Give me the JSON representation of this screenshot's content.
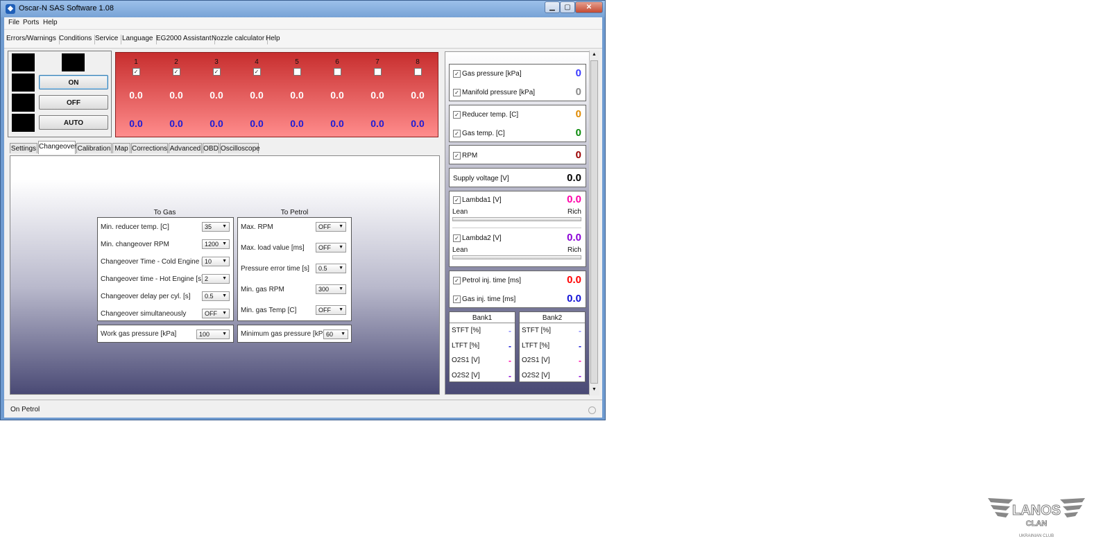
{
  "window": {
    "title": "Oscar-N SAS Software 1.08",
    "minimize": "▁",
    "maximize": "▢",
    "close": "✕"
  },
  "menu": [
    "File",
    "Ports",
    "Help"
  ],
  "toolbar": [
    "Errors/Warnings",
    "Conditions",
    "Service",
    "Language",
    "EG2000 Assistant",
    "Nozzle calculator",
    "Help"
  ],
  "mode_buttons": {
    "on": "ON",
    "off": "OFF",
    "auto": "AUTO"
  },
  "injectors": {
    "numbers": [
      "1",
      "2",
      "3",
      "4",
      "5",
      "6",
      "7",
      "8"
    ],
    "checked": [
      true,
      true,
      true,
      true,
      false,
      false,
      false,
      false
    ],
    "petrol": [
      "0.0",
      "0.0",
      "0.0",
      "0.0",
      "0.0",
      "0.0",
      "0.0",
      "0.0"
    ],
    "gas": [
      "0.0",
      "0.0",
      "0.0",
      "0.0",
      "0.0",
      "0.0",
      "0.0",
      "0.0"
    ]
  },
  "tabs": [
    "Settings",
    "Changeover",
    "Calibration",
    "Map",
    "Corrections",
    "Advanced",
    "OBD",
    "Oscilloscope"
  ],
  "active_tab": "Changeover",
  "to_gas": {
    "title": "To Gas",
    "rows": [
      {
        "label": "Min. reducer temp. [C]",
        "value": "35"
      },
      {
        "label": "Min. changeover RPM",
        "value": "1200"
      },
      {
        "label": "Changeover Time - Cold Engine [s]",
        "value": "10"
      },
      {
        "label": "Changeover time - Hot Engine [s]",
        "value": "2"
      },
      {
        "label": "Changeover delay per cyl. [s]",
        "value": "0.5"
      },
      {
        "label": "Changeover simultaneously",
        "value": "OFF"
      }
    ],
    "work_pressure": {
      "label": "Work gas pressure [kPa]",
      "value": "100"
    }
  },
  "to_petrol": {
    "title": "To Petrol",
    "rows": [
      {
        "label": "Max. RPM",
        "value": "OFF"
      },
      {
        "label": "Max. load value [ms]",
        "value": "OFF"
      },
      {
        "label": "Pressure error time [s]",
        "value": "0.5"
      },
      {
        "label": "Min. gas RPM",
        "value": "300"
      },
      {
        "label": "Min. gas Temp [C]",
        "value": "OFF"
      }
    ],
    "min_pressure": {
      "label": "Minimum gas pressure [kPa]",
      "value": "60"
    }
  },
  "sensors": {
    "gas_pressure": {
      "label": "Gas pressure [kPa]",
      "value": "0",
      "color": "#3a3aff"
    },
    "manifold_pressure": {
      "label": "Manifold pressure [kPa]",
      "value": "0",
      "color": "#8a8a8a"
    },
    "reducer_temp": {
      "label": "Reducer temp. [C]",
      "value": "0",
      "color": "#e08a00"
    },
    "gas_temp": {
      "label": "Gas temp. [C]",
      "value": "0",
      "color": "#0a8a0a"
    },
    "rpm": {
      "label": "RPM",
      "value": "0",
      "color": "#9a0000"
    },
    "supply_voltage": {
      "label": "Supply voltage [V]",
      "value": "0.0",
      "color": "#000000"
    },
    "lambda1": {
      "label": "Lambda1 [V]",
      "value": "0.0",
      "color": "#ff00aa",
      "lean": "Lean",
      "rich": "Rich"
    },
    "lambda2": {
      "label": "Lambda2 [V]",
      "value": "0.0",
      "color": "#8a00d6",
      "lean": "Lean",
      "rich": "Rich"
    },
    "petrol_inj": {
      "label": "Petrol inj. time [ms]",
      "value": "0.0",
      "color": "#ff0000"
    },
    "gas_inj": {
      "label": "Gas inj. time [ms]",
      "value": "0.0",
      "color": "#1010d6"
    }
  },
  "banks": [
    {
      "title": "Bank1",
      "rows": [
        "STFT [%]",
        "LTFT [%]",
        "O2S1 [V]",
        "O2S2 [V]"
      ],
      "value": "-"
    },
    {
      "title": "Bank2",
      "rows": [
        "STFT [%]",
        "LTFT [%]",
        "O2S1 [V]",
        "O2S2 [V]"
      ],
      "value": "-"
    }
  ],
  "bank_colors": [
    "#8a8aff",
    "#1010d6",
    "#ff00aa",
    "#8a00d6"
  ],
  "status": "On Petrol",
  "logo": {
    "text": "LANOS",
    "sub": "CLAN",
    "tag": "UKRAINIAN CLUB"
  }
}
